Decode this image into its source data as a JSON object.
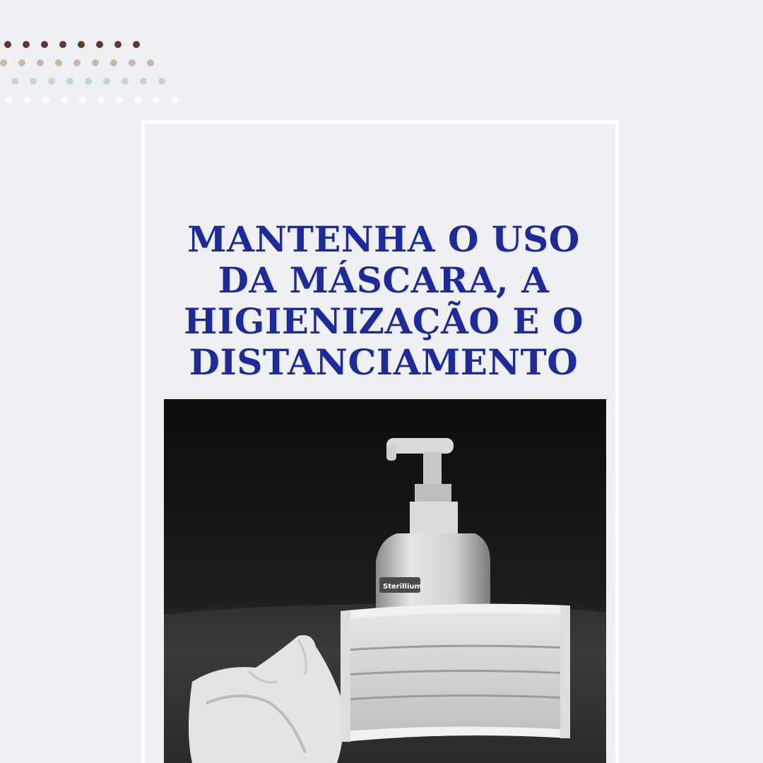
{
  "headline": {
    "lines": [
      "MANTENHA O USO",
      "DA MÁSCARA, A",
      "HIGIENIZAÇÃO E O",
      "DISTANCIAMENTO"
    ],
    "color": "#1c2a9e"
  },
  "photo": {
    "bottle_label": "Sterillium"
  },
  "decor": {
    "dot_colors": [
      "#5b3a33",
      "#cdb6a2",
      "#c5d3d8",
      "#ffffff"
    ]
  },
  "colors": {
    "background": "#eef0f4",
    "frame": "#ffffff"
  }
}
